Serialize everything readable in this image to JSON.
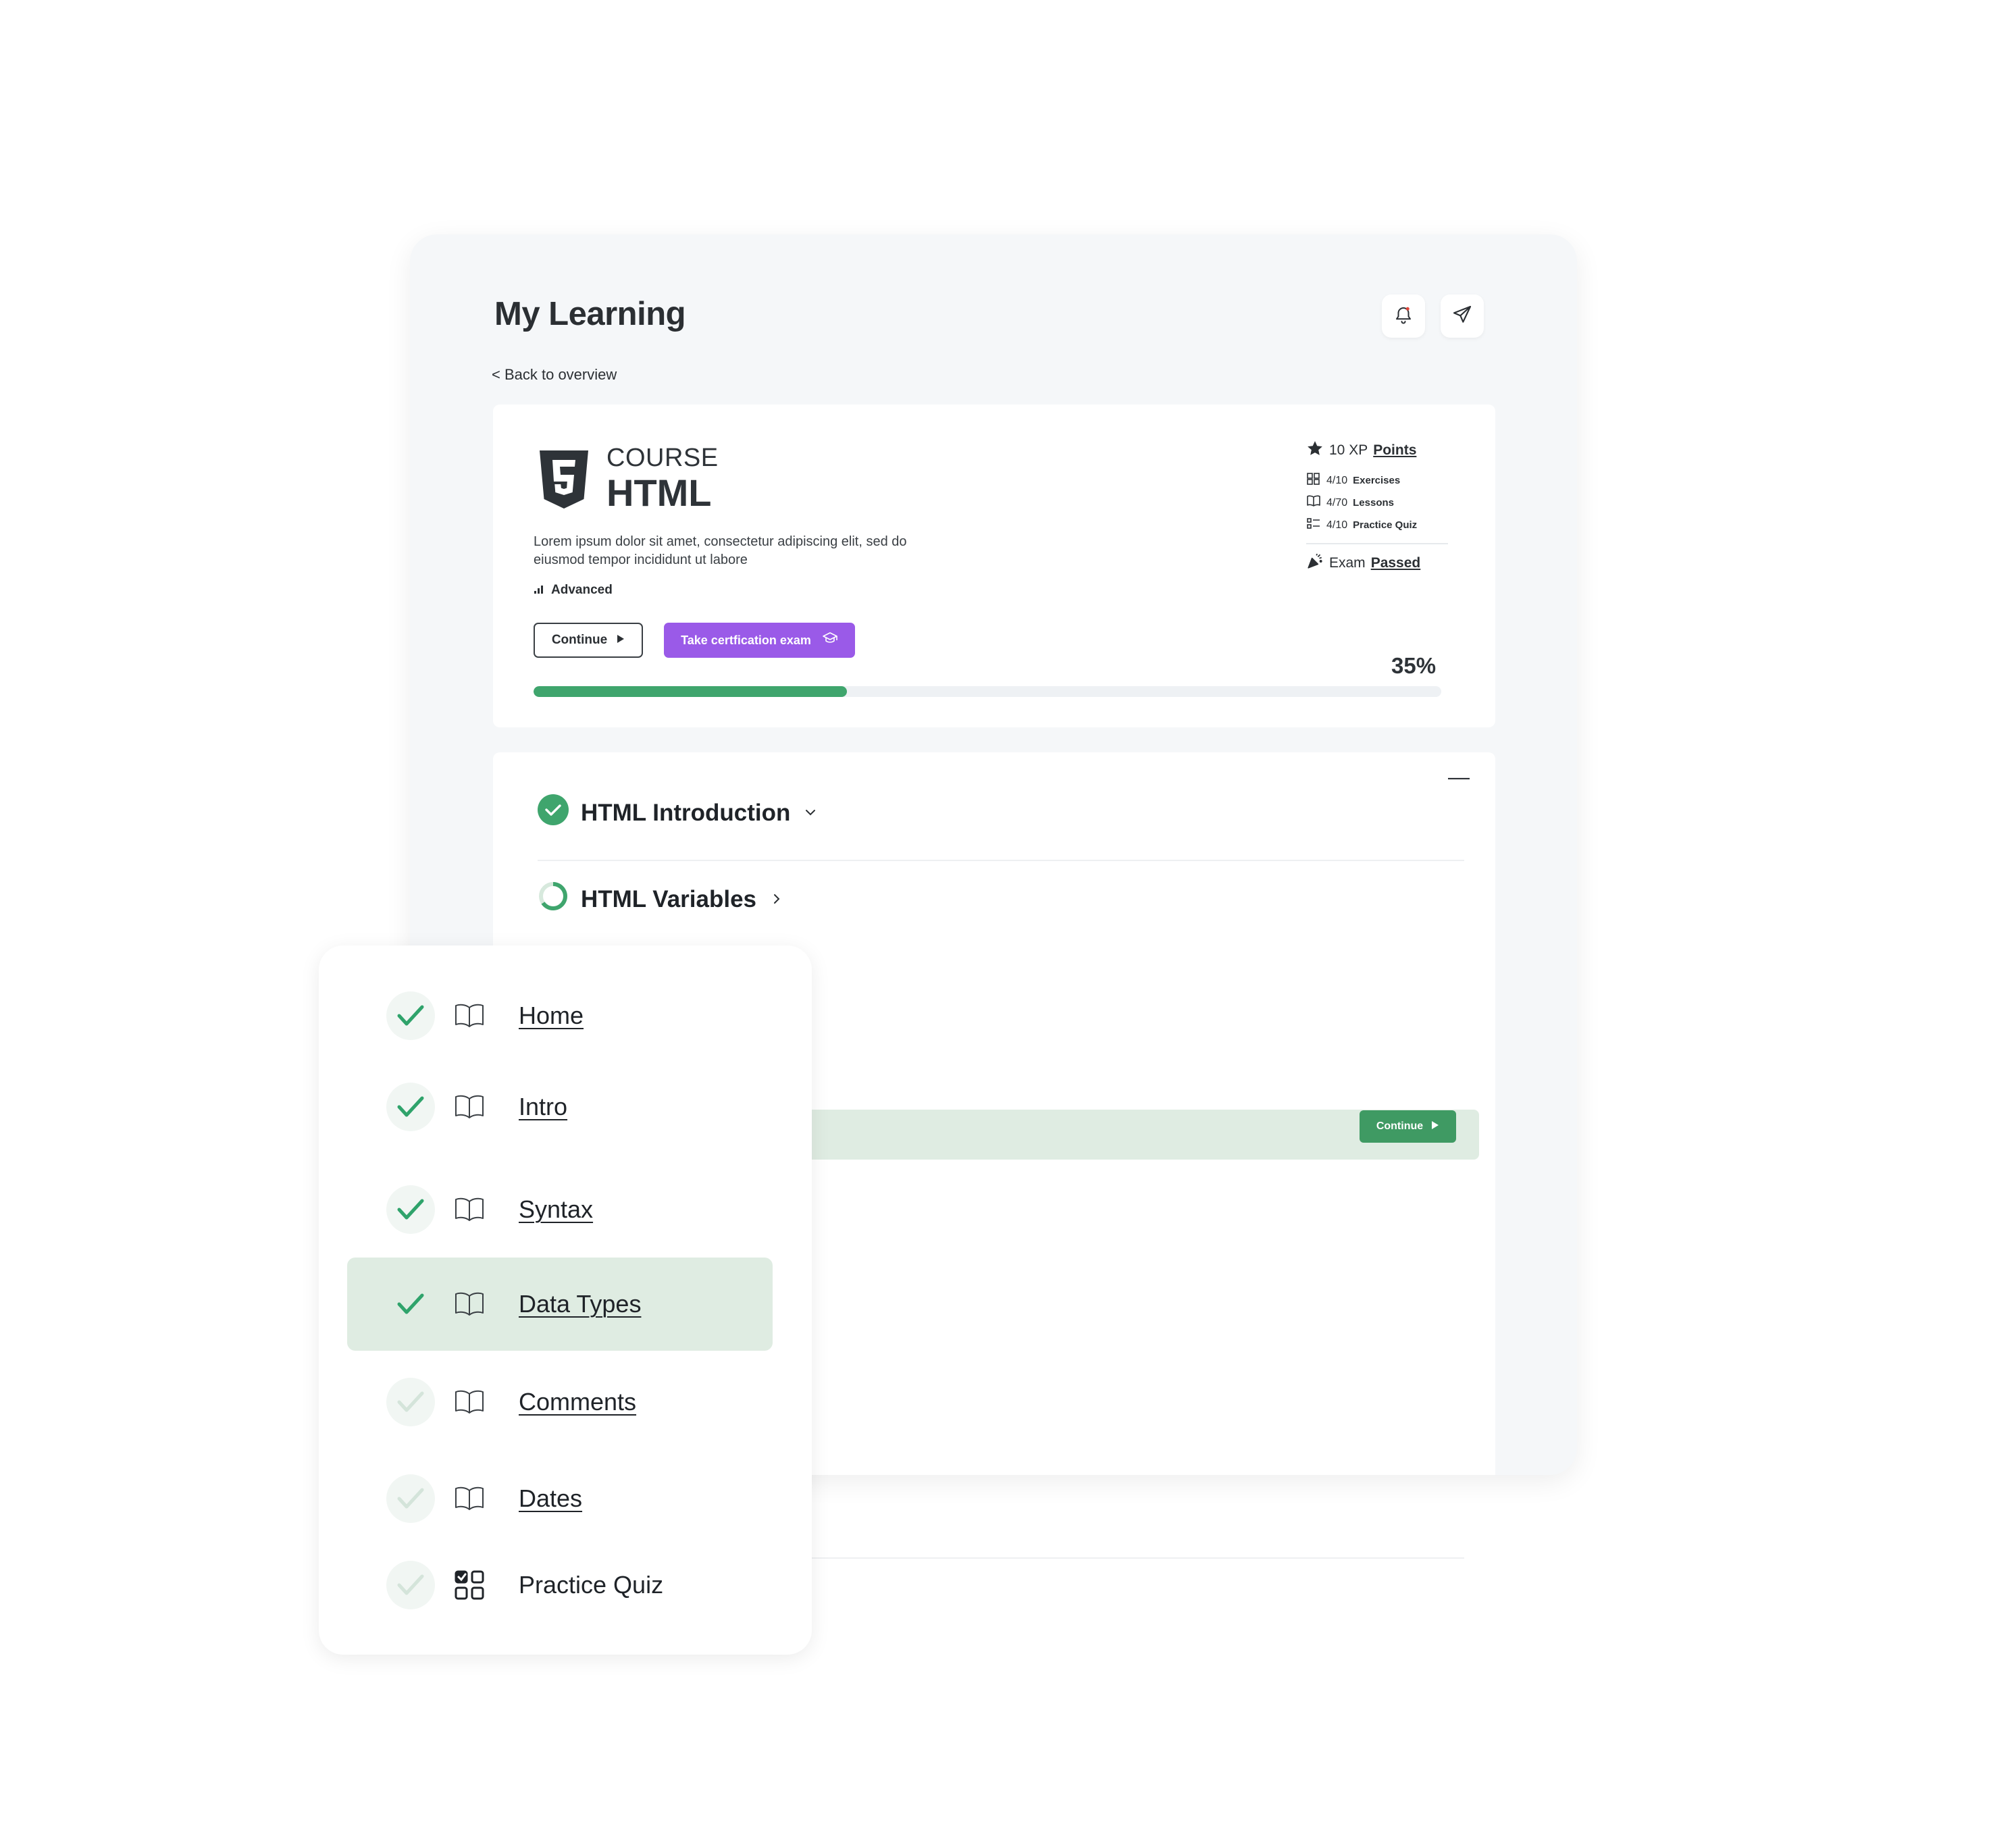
{
  "header": {
    "title": "My Learning",
    "back_link": "< Back to overview",
    "icons": [
      "bell-icon",
      "send-icon"
    ]
  },
  "course": {
    "kicker": "COURSE",
    "name": "HTML",
    "logo_icon": "html5-shield-icon",
    "description": "Lorem ipsum dolor sit amet, consectetur adipiscing elit, sed do eiusmod tempor incididunt ut labore",
    "level": "Advanced",
    "continue_label": "Continue",
    "cert_label": "Take certfication exam",
    "progress_percent": 35,
    "progress_label": "35%",
    "stats": {
      "xp_value": "10 XP",
      "xp_link": "Points",
      "exercises_count": "4/10",
      "exercises_label": "Exercises",
      "lessons_count": "4/70",
      "lessons_label": "Lessons",
      "quiz_count": "4/10",
      "quiz_label": "Practice Quiz",
      "exam_label": "Exam",
      "exam_status": "Passed"
    }
  },
  "modules": {
    "collapse_symbol": "—",
    "items": [
      {
        "title": "HTML Introduction",
        "status": "complete",
        "expanded": true
      },
      {
        "title": "HTML Variables",
        "status": "in-progress",
        "expanded": false
      }
    ],
    "row_continue_label": "Continue"
  },
  "lessons": [
    {
      "label": "Home",
      "done": true,
      "type": "lesson",
      "link": true
    },
    {
      "label": "Intro",
      "done": true,
      "type": "lesson",
      "link": true
    },
    {
      "label": "Syntax",
      "done": true,
      "type": "lesson",
      "link": true
    },
    {
      "label": "Data Types",
      "done": true,
      "type": "lesson",
      "link": true,
      "active": true
    },
    {
      "label": "Comments",
      "done": false,
      "type": "lesson",
      "link": true
    },
    {
      "label": "Dates",
      "done": false,
      "type": "lesson",
      "link": true
    },
    {
      "label": "Practice Quiz",
      "done": false,
      "type": "quiz",
      "link": false
    }
  ],
  "colors": {
    "accent_green": "#3fa56d",
    "accent_purple": "#9a5ae8",
    "highlight_green": "#dfece2",
    "frame_bg": "#f5f7f9"
  }
}
